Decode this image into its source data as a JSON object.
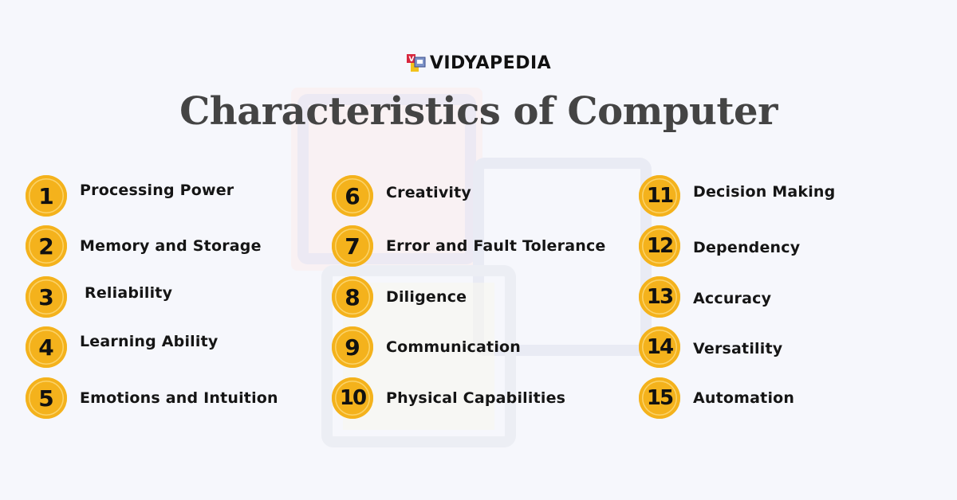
{
  "brand": {
    "name": "VIDYAPEDIA",
    "logo_icon": "vidyapedia-logo-icon"
  },
  "title": "Characteristics of Computer",
  "colors": {
    "badge": "#f4b21c",
    "background": "#f6f7fc",
    "title": "#444444",
    "text": "#151515"
  },
  "columns": [
    {
      "items": [
        {
          "number": "1",
          "label": "Processing Power"
        },
        {
          "number": "2",
          "label": "Memory and Storage"
        },
        {
          "number": "3",
          "label": "Reliability"
        },
        {
          "number": "4",
          "label": "Learning Ability"
        },
        {
          "number": "5",
          "label": "Emotions and Intuition"
        }
      ]
    },
    {
      "items": [
        {
          "number": "6",
          "label": "Creativity"
        },
        {
          "number": "7",
          "label": "Error and Fault Tolerance"
        },
        {
          "number": "8",
          "label": "Diligence"
        },
        {
          "number": "9",
          "label": "Communication"
        },
        {
          "number": "10",
          "label": "Physical Capabilities"
        }
      ]
    },
    {
      "items": [
        {
          "number": "11",
          "label": "Decision Making"
        },
        {
          "number": "12",
          "label": "Dependency"
        },
        {
          "number": "13",
          "label": "Accuracy"
        },
        {
          "number": "14",
          "label": "Versatility"
        },
        {
          "number": "15",
          "label": "Automation"
        }
      ]
    }
  ]
}
